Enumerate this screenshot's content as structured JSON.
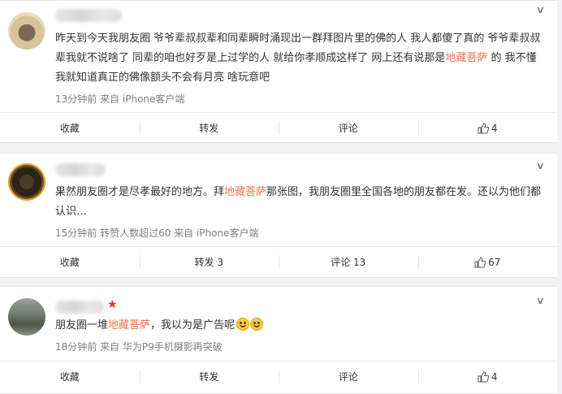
{
  "comments": [
    {
      "text_parts": [
        "昨天到今天我朋友圈 爷爷辈叔叔辈和同辈瞬时涌现出一群拜图片里的佛的人 我人都傻了真的 爷爷辈叔叔辈我就不说啥了 同辈的咱也好歹是上过学的人 就给你孝顺成这样了 网上还有说那是",
        "地藏菩萨",
        " 的 我不懂 我就知道真正的佛像额头不会有月亮 啥玩意吧"
      ],
      "meta": "13分钟前 来自 iPhone客户端",
      "actions": {
        "collect": "收藏",
        "repost": "转发",
        "comment": "评论",
        "likes": "4"
      }
    },
    {
      "text_parts": [
        "果然朋友圈才是尽孝最好的地方。拜",
        "地藏菩萨",
        "那张图，我朋友圈里全国各地的朋友都在发。还以为他们都认识…"
      ],
      "meta": "15分钟前 转赞人数超过60 来自 iPhone客户端",
      "actions": {
        "collect": "收藏",
        "repost": "转发 3",
        "comment": "评论 13",
        "likes": "67"
      }
    },
    {
      "text_parts": [
        "朋友圈一堆",
        "地藏菩萨",
        "，我以为是广告呢"
      ],
      "meta": "18分钟前 来自 华为P9手机摄影再突破",
      "actions": {
        "collect": "收藏",
        "repost": "转发",
        "comment": "评论",
        "likes": "4"
      }
    }
  ],
  "icons": {
    "more": "chevron-down-icon",
    "like": "thumbs-up-icon",
    "vip": "star-icon",
    "emoji": "laughing-emoji-icon"
  },
  "colors": {
    "highlight": "#eb7350",
    "meta": "#808080",
    "background": "#f2f2f5"
  }
}
